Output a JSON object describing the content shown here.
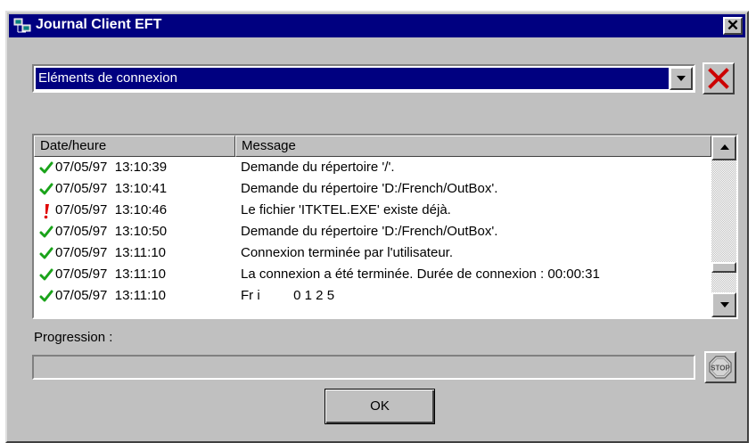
{
  "window": {
    "title": "Journal Client EFT",
    "close_label": "✕"
  },
  "combo": {
    "selected": "Eléments de connexion"
  },
  "list": {
    "columns": [
      "Date/heure",
      "Message"
    ],
    "rows": [
      {
        "status": "ok",
        "datetime": "07/05/97  13:10:39",
        "message": "Demande du répertoire '/'."
      },
      {
        "status": "ok",
        "datetime": "07/05/97  13:10:41",
        "message": "Demande du répertoire 'D:/French/OutBox'."
      },
      {
        "status": "warning",
        "datetime": "07/05/97  13:10:46",
        "message": "Le fichier 'ITKTEL.EXE' existe déjà."
      },
      {
        "status": "ok",
        "datetime": "07/05/97  13:10:50",
        "message": "Demande du répertoire 'D:/French/OutBox'."
      },
      {
        "status": "ok",
        "datetime": "07/05/97  13:11:10",
        "message": "Connexion terminée par l'utilisateur."
      },
      {
        "status": "ok",
        "datetime": "07/05/97  13:11:10",
        "message": "La connexion a été terminée. Durée de connexion : 00:00:31"
      },
      {
        "status": "ok",
        "datetime": "07/05/97  13:11:10",
        "message": "Fr i         0 1 2 5"
      }
    ]
  },
  "progress": {
    "label": "Progression :",
    "value": 0
  },
  "stop_button": {
    "label": "STOP"
  },
  "ok_button": {
    "label": "OK"
  },
  "colors": {
    "titlebar": "#000080",
    "ok_icon": "#1aa31a",
    "warning_icon": "#e00000",
    "clear_icon": "#cc0000"
  },
  "icons": {
    "app": "network-computers-icon",
    "clear": "red-x-icon",
    "stop": "stop-sign-icon",
    "ok": "green-check-icon",
    "warning": "red-exclamation-icon"
  }
}
